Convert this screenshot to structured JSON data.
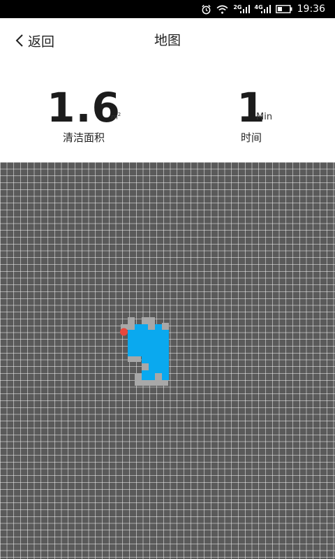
{
  "status_bar": {
    "time": "19:36",
    "net_2g": "2G",
    "net_4g": "4G",
    "icons": [
      "alarm-icon",
      "wifi-icon",
      "signal-icon",
      "signal-icon",
      "battery-icon"
    ]
  },
  "header": {
    "back_label": "返回",
    "title": "地图"
  },
  "stats": {
    "area_value": "1.6",
    "area_unit": "m",
    "area_unit_sup": "2",
    "area_label": "清洁面积",
    "time_value": "1",
    "time_unit": "Min",
    "time_label": "时间"
  },
  "map": {
    "colors": {
      "background": "#5a5a5a",
      "grid_line": "#ffffff",
      "cleaned": "#0aa9ef",
      "obstacle": "#a8a8a8",
      "robot": "#e8473d"
    }
  }
}
